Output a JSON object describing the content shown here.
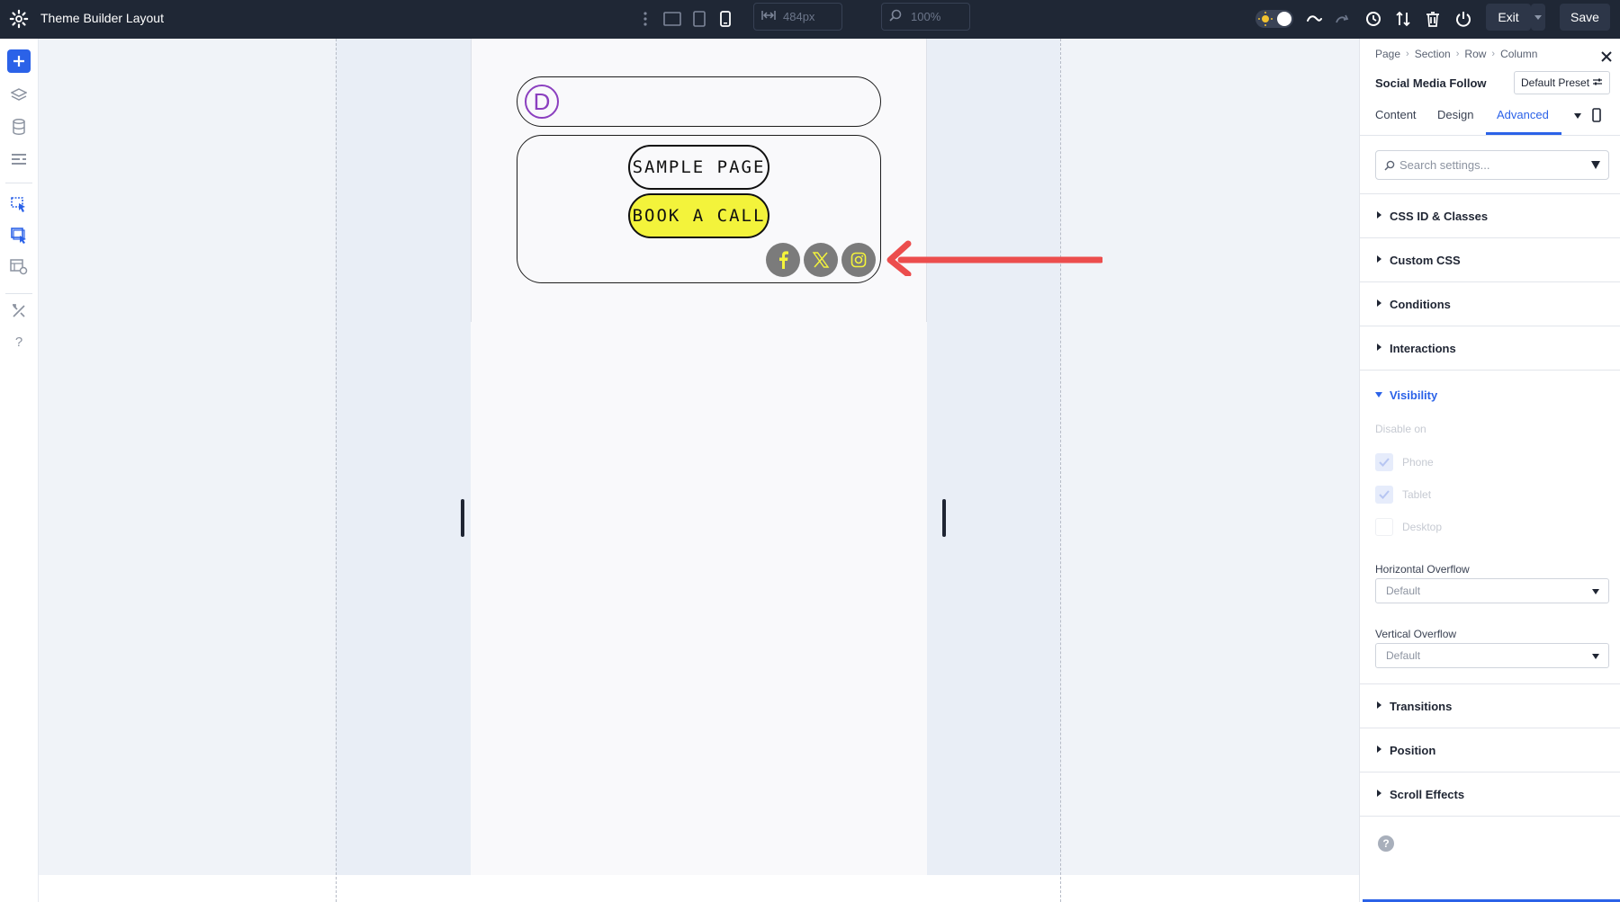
{
  "app": {
    "title": "Theme Builder Layout"
  },
  "toolbar": {
    "width_value": "484px",
    "zoom_value": "100%",
    "exit_label": "Exit",
    "save_label": "Save"
  },
  "canvas": {
    "logo_letter": "D",
    "menu_items": [
      "SAMPLE PAGE",
      "BOOK A CALL"
    ],
    "social_icons": [
      "facebook-icon",
      "x-icon",
      "instagram-icon"
    ]
  },
  "panel": {
    "breadcrumbs": [
      "Page",
      "Section",
      "Row",
      "Column"
    ],
    "module_title": "Social Media Follow",
    "preset_label": "Default Preset",
    "tabs": [
      "Content",
      "Design",
      "Advanced"
    ],
    "active_tab": "Advanced",
    "search_placeholder": "Search settings...",
    "sections_top": [
      "CSS ID & Classes",
      "Custom CSS",
      "Conditions",
      "Interactions"
    ],
    "visibility": {
      "title": "Visibility",
      "disable_on_label": "Disable on",
      "options": [
        {
          "label": "Phone",
          "checked": true
        },
        {
          "label": "Tablet",
          "checked": true
        },
        {
          "label": "Desktop",
          "checked": false
        }
      ],
      "horizontal_overflow_label": "Horizontal Overflow",
      "horizontal_overflow_value": "Default",
      "vertical_overflow_label": "Vertical Overflow",
      "vertical_overflow_value": "Default"
    },
    "sections_bottom": [
      "Transitions",
      "Position",
      "Scroll Effects"
    ]
  },
  "colors": {
    "accent": "#2b62e8",
    "topbar": "#1f2735",
    "cta_yellow": "#f3f33b",
    "arrow": "#ec4d4d"
  }
}
